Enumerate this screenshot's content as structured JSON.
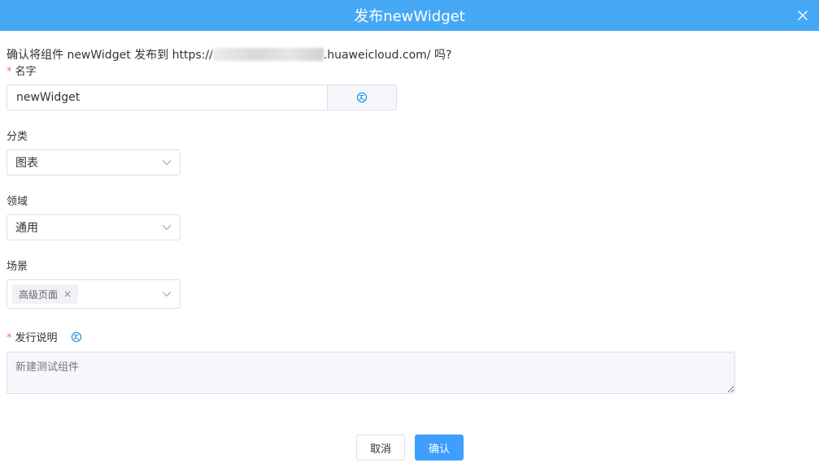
{
  "dialog": {
    "title": "发布newWidget",
    "confirm_prefix": "确认将组件 newWidget 发布到 https://",
    "confirm_suffix": ".huaweicloud.com/ 吗?"
  },
  "form": {
    "name": {
      "label": "名字",
      "required_mark": "*",
      "value": "newWidget"
    },
    "category": {
      "label": "分类",
      "selected": "图表"
    },
    "domain": {
      "label": "领域",
      "selected": "通用"
    },
    "scene": {
      "label": "场景",
      "tags": [
        "高级页面"
      ],
      "tag_close": "×"
    },
    "release_notes": {
      "label": "发行说明",
      "required_mark": "*",
      "placeholder": "新建测试组件"
    }
  },
  "footer": {
    "cancel_label": "取消",
    "confirm_label": "确认"
  },
  "colors": {
    "header": "#45a8f5",
    "primary": "#409eff",
    "required": "#f56c6c",
    "icon": "#2d9cdb"
  },
  "icons": {
    "close": "close-icon",
    "translate": "translate-icon",
    "chevron": "chevron-down-icon"
  }
}
